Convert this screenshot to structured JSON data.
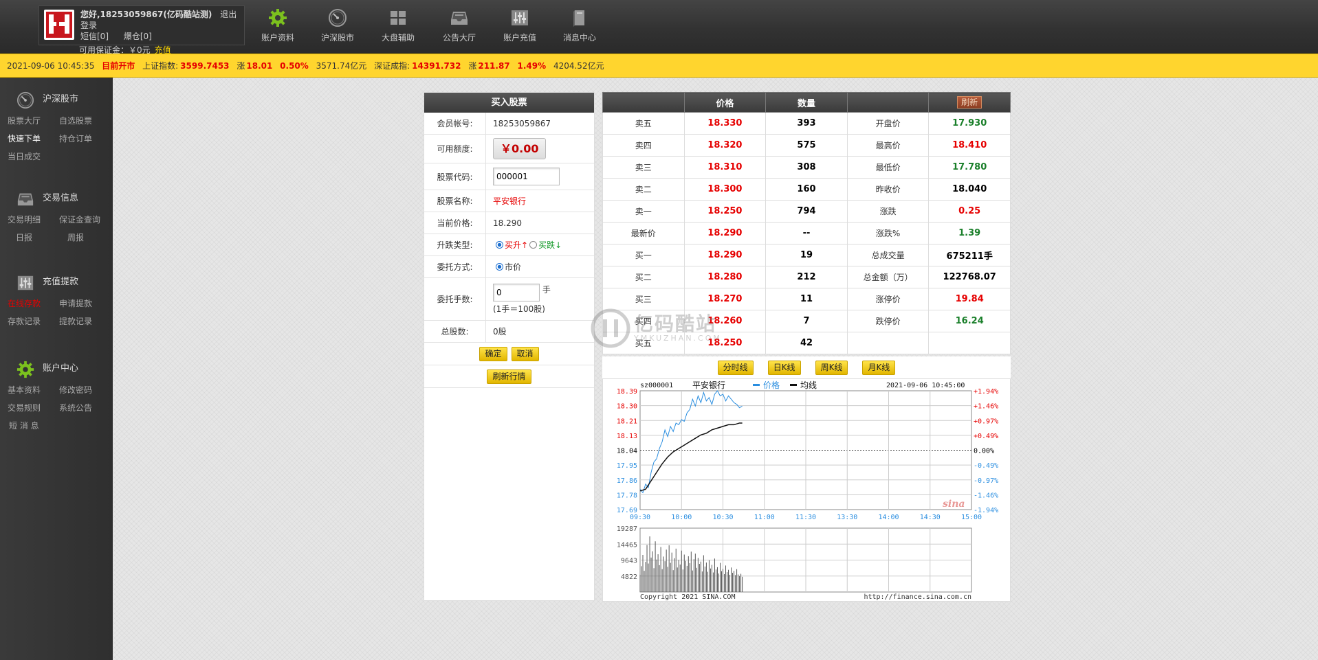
{
  "header": {
    "greeting": "您好,18253059867(亿码酷站测)",
    "logout": "退出登录",
    "sms": "短信[0]",
    "blowup": "爆仓[0]",
    "margin_label": "可用保证金：",
    "margin_value": "￥0元",
    "recharge": "充值",
    "nav": [
      "账户资料",
      "沪深股市",
      "大盘辅助",
      "公告大厅",
      "账户充值",
      "消息中心"
    ]
  },
  "ticker": {
    "datetime": "2021-09-06 10:45:35",
    "market_status": "目前开市",
    "sh_label": "上证指数:",
    "sh_index": "3599.7453",
    "sh_change_label": "涨",
    "sh_change": "18.01",
    "sh_pct": "0.50%",
    "sh_amount": "3571.74亿元",
    "sz_label": "深证成指:",
    "sz_index": "14391.732",
    "sz_change_label": "涨",
    "sz_change": "211.87",
    "sz_pct": "1.49%",
    "sz_amount": "4204.52亿元"
  },
  "sidebar": [
    {
      "title": "沪深股市",
      "icon": "gauge-icon",
      "links": [
        "股票大厅",
        "自选股票",
        "快速下单",
        "持仓订单",
        "当日成交"
      ]
    },
    {
      "title": "交易信息",
      "icon": "tray-icon",
      "links": [
        "交易明细",
        "保证金查询",
        "日报",
        "周报"
      ]
    },
    {
      "title": "充值提款",
      "icon": "sliders-icon",
      "links": [
        "在线存款",
        "申请提款",
        "存款记录",
        "提款记录"
      ]
    },
    {
      "title": "账户中心",
      "icon": "gear-icon",
      "links": [
        "基本资料",
        "修改密码",
        "交易规则",
        "系统公告",
        "短 消 息"
      ]
    }
  ],
  "buy_form": {
    "title": "买入股票",
    "account_label": "会员帐号:",
    "account": "18253059867",
    "quota_label": "可用额度:",
    "quota": "￥0.00",
    "code_label": "股票代码:",
    "code": "000001",
    "name_label": "股票名称:",
    "name": "平安银行",
    "price_label": "当前价格:",
    "price": "18.290",
    "type_label": "升跌类型:",
    "type_up": "买升↑",
    "type_down": "买跌↓",
    "order_label": "委托方式:",
    "order_market": "市价",
    "lots_label": "委托手数:",
    "lots": "0",
    "lots_unit": "手",
    "lots_hint": "(1手＝100股)",
    "total_label": "总股数:",
    "total": "0股",
    "confirm": "确定",
    "cancel": "取消",
    "refresh": "刷新行情"
  },
  "quote": {
    "headers": [
      "",
      "价格",
      "数量",
      "",
      ""
    ],
    "refresh": "刷新",
    "rows": [
      {
        "label": "卖五",
        "price": "18.330",
        "qty": "393",
        "k": "开盘价",
        "v": "17.930",
        "vc": "g"
      },
      {
        "label": "卖四",
        "price": "18.320",
        "qty": "575",
        "k": "最高价",
        "v": "18.410",
        "vc": "r"
      },
      {
        "label": "卖三",
        "price": "18.310",
        "qty": "308",
        "k": "最低价",
        "v": "17.780",
        "vc": "g"
      },
      {
        "label": "卖二",
        "price": "18.300",
        "qty": "160",
        "k": "昨收价",
        "v": "18.040",
        "vc": "k"
      },
      {
        "label": "卖一",
        "price": "18.250",
        "qty": "794",
        "k": "涨跌",
        "v": "0.25",
        "vc": "r"
      },
      {
        "label": "最新价",
        "price": "18.290",
        "qty": "--",
        "k": "涨跌%",
        "v": "1.39",
        "vc": "g"
      },
      {
        "label": "买一",
        "price": "18.290",
        "qty": "19",
        "k": "总成交量",
        "v": "675211手",
        "vc": "k"
      },
      {
        "label": "买二",
        "price": "18.280",
        "qty": "212",
        "k": "总金额（万）",
        "v": "122768.07",
        "vc": "k"
      },
      {
        "label": "买三",
        "price": "18.270",
        "qty": "11",
        "k": "涨停价",
        "v": "19.84",
        "vc": "r"
      },
      {
        "label": "买四",
        "price": "18.260",
        "qty": "7",
        "k": "跌停价",
        "v": "16.24",
        "vc": "g"
      },
      {
        "label": "买五",
        "price": "18.250",
        "qty": "42",
        "k": "",
        "v": "",
        "vc": "k"
      }
    ]
  },
  "kline_buttons": [
    "分时线",
    "日K线",
    "周K线",
    "月K线"
  ],
  "chart_data": {
    "type": "line",
    "symbol": "sz000001",
    "title": "平安银行",
    "datetime": "2021-09-06 10:45:00",
    "legend": [
      "价格",
      "均线"
    ],
    "x_ticks": [
      "09:30",
      "10:00",
      "10:30",
      "11:00",
      "11:30",
      "13:30",
      "14:00",
      "14:30",
      "15:00"
    ],
    "y_ticks": [
      "18.39",
      "18.30",
      "18.21",
      "18.13",
      "18.04",
      "17.95",
      "17.86",
      "17.78",
      "17.69"
    ],
    "y_pct_ticks": [
      "+1.94%",
      "+1.46%",
      "+0.97%",
      "+0.49%",
      "0.00%",
      "-0.49%",
      "-0.97%",
      "-1.46%",
      "-1.94%"
    ],
    "ylim": [
      17.69,
      18.39
    ],
    "prev_close": 18.04,
    "series": [
      {
        "name": "价格",
        "color": "#2a8ee0",
        "x": [
          0,
          2,
          4,
          6,
          8,
          10,
          12,
          14,
          16,
          18,
          20,
          22,
          24,
          26,
          28,
          30,
          32,
          34,
          36,
          38,
          40,
          42,
          44,
          46,
          48,
          50,
          52,
          54,
          56,
          58,
          60,
          62,
          64,
          66,
          68,
          70,
          72,
          74
        ],
        "values": [
          17.81,
          17.79,
          17.84,
          17.82,
          17.91,
          17.97,
          17.99,
          18.05,
          18.09,
          18.16,
          18.12,
          18.18,
          18.15,
          18.2,
          18.19,
          18.22,
          18.21,
          18.26,
          18.28,
          18.34,
          18.3,
          18.36,
          18.32,
          18.38,
          18.33,
          18.35,
          18.31,
          18.37,
          18.39,
          18.36,
          18.37,
          18.33,
          18.36,
          18.34,
          18.32,
          18.31,
          18.29,
          18.3
        ]
      },
      {
        "name": "均线",
        "color": "#111111",
        "x": [
          0,
          4,
          8,
          12,
          16,
          20,
          24,
          28,
          32,
          36,
          40,
          44,
          48,
          52,
          56,
          60,
          64,
          68,
          72,
          74
        ],
        "values": [
          17.8,
          17.81,
          17.86,
          17.91,
          17.96,
          18.0,
          18.03,
          18.05,
          18.07,
          18.09,
          18.11,
          18.13,
          18.14,
          18.16,
          18.17,
          18.18,
          18.19,
          18.19,
          18.2,
          18.2
        ]
      }
    ],
    "volume": {
      "y_ticks": [
        "19287",
        "14465",
        "9643",
        "4822"
      ],
      "ylim": [
        0,
        19287
      ],
      "values": [
        5200,
        7800,
        11200,
        6400,
        9100,
        14200,
        8600,
        16800,
        10400,
        12300,
        7200,
        15300,
        9800,
        11400,
        8100,
        13600,
        6900,
        10700,
        9300,
        12800,
        7600,
        14100,
        8800,
        11900,
        6600,
        10200,
        13100,
        7400,
        9700,
        8300,
        12500,
        6800,
        11300,
        9400,
        7900,
        10800,
        8700,
        12200,
        6500,
        9900,
        11600,
        7300,
        10300,
        8500,
        9200,
        6200,
        11100,
        7700,
        8900,
        6100,
        9600,
        7100,
        8200,
        5900,
        10100,
        6800,
        7500,
        5600,
        8800,
        6300,
        7000,
        5400,
        8000,
        6000,
        6700,
        5200,
        7400,
        5800,
        6400,
        5100,
        6900,
        5300,
        4800,
        5500,
        4600
      ]
    },
    "footer_left": "Copyright 2021 SINA.COM",
    "footer_right": "http://finance.sina.com.cn",
    "brand": "sina"
  },
  "watermark": {
    "title": "亿码酷站",
    "sub": "YMKUZHAN.COM"
  }
}
